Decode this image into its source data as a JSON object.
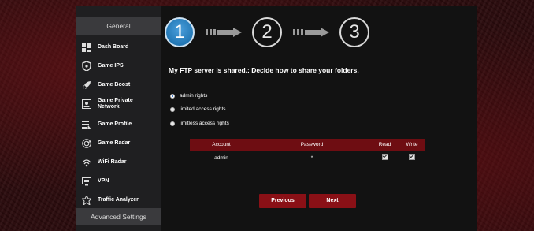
{
  "sidebar": {
    "general_header": "General",
    "advanced_header": "Advanced Settings",
    "items": [
      {
        "label": "Dash Board",
        "icon": "dashboard-icon"
      },
      {
        "label": "Game IPS",
        "icon": "shield-icon"
      },
      {
        "label": "Game Boost",
        "icon": "rocket-icon"
      },
      {
        "label": "Game Private Network",
        "icon": "network-icon"
      },
      {
        "label": "Game Profile",
        "icon": "profile-icon"
      },
      {
        "label": "Game Radar",
        "icon": "radar-icon"
      },
      {
        "label": "WiFi Radar",
        "icon": "wifi-radar-icon"
      },
      {
        "label": "VPN",
        "icon": "vpn-icon"
      },
      {
        "label": "Traffic Analyzer",
        "icon": "traffic-analyzer-icon"
      }
    ]
  },
  "wizard": {
    "steps": [
      "1",
      "2",
      "3"
    ],
    "active_step": 1
  },
  "main": {
    "instruction": "My FTP server is shared.: Decide how to share your folders.",
    "options": [
      {
        "label": "admin rights",
        "checked": true
      },
      {
        "label": "limited access rights",
        "checked": false
      },
      {
        "label": "limitless access rights",
        "checked": false
      }
    ]
  },
  "table": {
    "headers": {
      "account": "Account",
      "password": "Password",
      "read": "Read",
      "write": "Write"
    },
    "rows": [
      {
        "account": "admin",
        "password": "*",
        "read": true,
        "write": true
      }
    ]
  },
  "buttons": {
    "previous": "Previous",
    "next": "Next"
  },
  "colors": {
    "accent": "#8a1016",
    "table_header": "#6e0d12",
    "active_step": "#2a82c4"
  }
}
